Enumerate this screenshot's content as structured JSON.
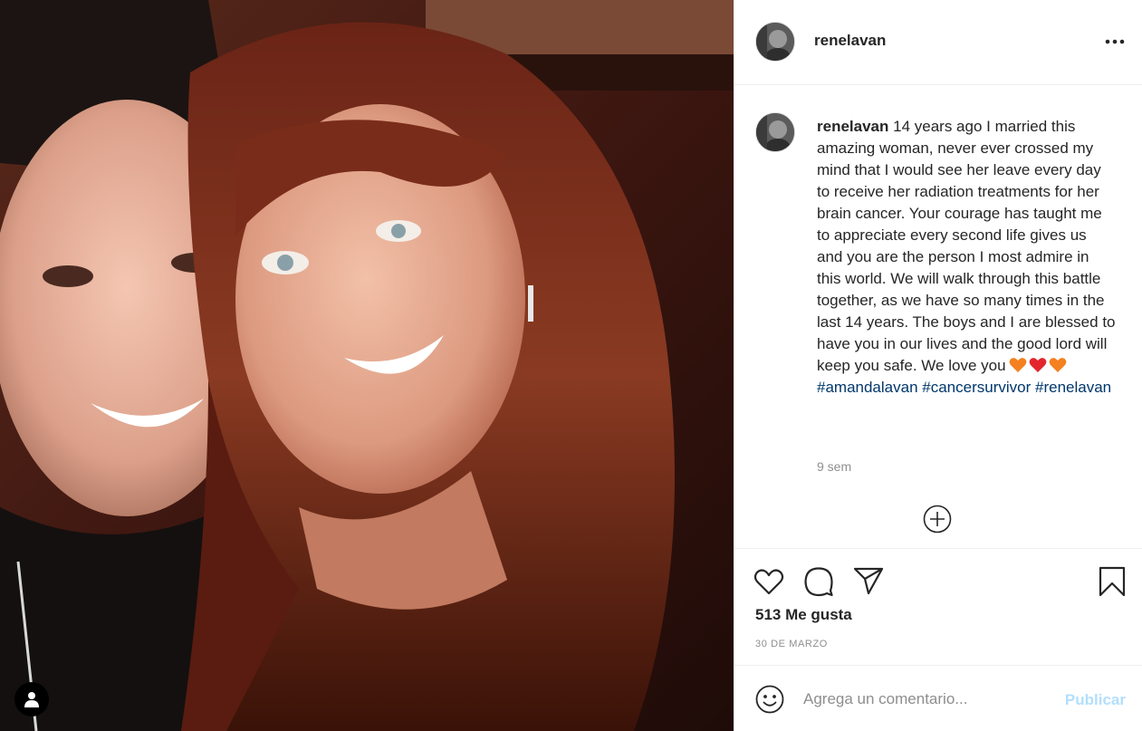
{
  "post": {
    "username": "renelavan",
    "caption": {
      "username": "renelavan",
      "text": "14 years ago I married this amazing woman, never ever crossed my mind that I would see her leave every day to receive her radiation treatments for her brain cancer. Your courage has taught me to appreciate every second life gives us and you are the person I most admire in this world. We will walk through this battle together, as we have so many times in the last 14 years. The boys and I are blessed to have you in our lives and the good lord will keep you safe. We love you",
      "hashtags": [
        "#amandalavan",
        "#cancersurvivor",
        "#renelavan"
      ]
    },
    "time_ago": "9 sem",
    "likes": "513 Me gusta",
    "date": "30 DE MARZO"
  },
  "comment_box": {
    "placeholder": "Agrega un comentario...",
    "publish_label": "Publicar"
  },
  "icons": {
    "more": "more-options-icon",
    "like": "heart-icon",
    "comment": "comment-bubble-icon",
    "share": "paper-plane-icon",
    "save": "bookmark-icon",
    "load_more": "plus-circle-icon",
    "emoji": "emoji-smiley-icon",
    "tag_user": "user-tag-icon",
    "caption_emojis": [
      "orange-heart",
      "red-heart",
      "orange-heart"
    ]
  },
  "colors": {
    "link": "#00376b",
    "muted": "#8e8e8e",
    "publish_disabled": "#b2dffc",
    "text": "#262626"
  }
}
